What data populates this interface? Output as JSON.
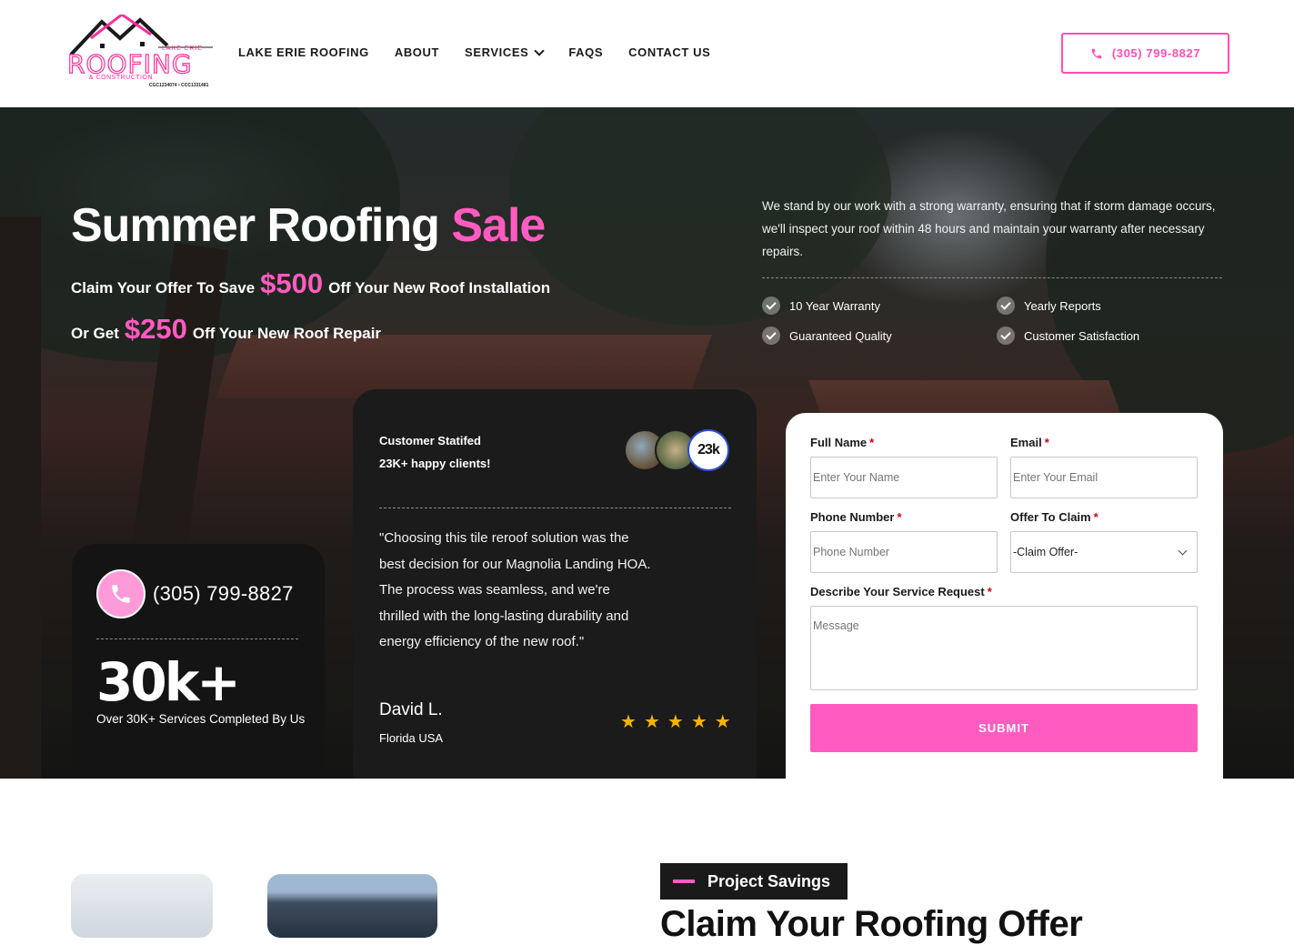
{
  "brand": {
    "top_text": "LAKE ERIE",
    "wordmark": "ROOFING",
    "sub": "& CONSTRUCTION",
    "license": "CGC1234074 • CCC1331481"
  },
  "nav": {
    "items": [
      {
        "label": "LAKE ERIE ROOFING"
      },
      {
        "label": "ABOUT"
      },
      {
        "label": "SERVICES"
      },
      {
        "label": "FAQS"
      },
      {
        "label": "CONTACT US"
      }
    ],
    "phone": "(305) 799-8827"
  },
  "hero": {
    "title_main": "Summer Roofing ",
    "title_accent": "Sale",
    "offer1_pre": "Claim Your Offer To Save",
    "offer1_amount": "$500",
    "offer1_post": "Off Your New Roof Installation",
    "offer2_pre": "Or Get",
    "offer2_amount": "$250",
    "offer2_post": "Off Your New Roof Repair",
    "warranty_text": "We stand by our work with a strong warranty, ensuring that if storm damage occurs, we'll inspect your roof within 48 hours and maintain your warranty after necessary repairs.",
    "features": [
      "10 Year Warranty",
      "Yearly Reports",
      "Guaranteed Quality",
      "Customer Satisfaction"
    ]
  },
  "stats": {
    "phone": "(305) 799-8827",
    "big": "30k+",
    "desc": "Over 30K+ Services Completed By Us"
  },
  "testimonial": {
    "head1": "Customer Statifed",
    "head2": "23K+ happy clients!",
    "avatar_count": "23k",
    "quote": "\"Choosing this tile reroof solution was the best decision for our Magnolia Landing HOA. The process was seamless, and we're thrilled with the long-lasting durability and energy efficiency of the new roof.\"",
    "author": "David L.",
    "location": "Florida USA",
    "rating": 5
  },
  "form": {
    "name_label": "Full Name",
    "name_placeholder": "Enter Your Name",
    "email_label": "Email",
    "email_placeholder": "Enter Your Email",
    "phone_label": "Phone Number",
    "phone_placeholder": "Phone Number",
    "offer_label": "Offer To Claim",
    "offer_value": "-Claim Offer-",
    "message_label": "Describe Your Service Request",
    "message_placeholder": "Message",
    "submit": "SUBMIT",
    "required_mark": "*"
  },
  "section": {
    "badge": "Project Savings",
    "title": "Claim Your Roofing Offer"
  },
  "colors": {
    "accent": "#ff5bc0",
    "dark_card": "#1b1b1b",
    "star": "#f8b400"
  }
}
